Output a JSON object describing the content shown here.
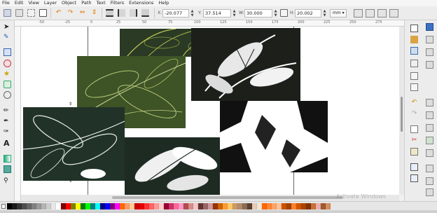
{
  "menu": [
    "File",
    "Edit",
    "View",
    "Layer",
    "Object",
    "Path",
    "Text",
    "Filters",
    "Extensions",
    "Help"
  ],
  "toolbar": {
    "x_label": "X:",
    "x_value": "-20.077",
    "y_label": "Y:",
    "y_value": "37.514",
    "w_label": "W:",
    "w_value": "30.000",
    "h_label": "H:",
    "h_value": "20.002",
    "unit": "mm"
  },
  "ruler": {
    "ticks": [
      "-50",
      "-25",
      "0",
      "25",
      "50",
      "75",
      "100",
      "125",
      "150",
      "175",
      "200",
      "225",
      "250",
      "275"
    ]
  },
  "palette": {
    "colors": [
      "#000000",
      "#1a1a1a",
      "#333333",
      "#4d4d4d",
      "#666666",
      "#808080",
      "#999999",
      "#b3b3b3",
      "#cccccc",
      "#e6e6e6",
      "#ffffff",
      "#800000",
      "#ff0000",
      "#808000",
      "#ffff00",
      "#008000",
      "#00ff00",
      "#008080",
      "#00ffff",
      "#000080",
      "#0000ff",
      "#800080",
      "#ff00ff",
      "#ff6600",
      "#ff9966",
      "#ffcc99",
      "#cc0000",
      "#e60000",
      "#ff3333",
      "#ff6666",
      "#ff9999",
      "#ffcccc",
      "#990033",
      "#cc3366",
      "#ff6699",
      "#ff99cc",
      "#b34d4d",
      "#d98c8c",
      "#f2c6c6",
      "#663333",
      "#996666",
      "#cc9999",
      "#993300",
      "#cc6600",
      "#ff9933",
      "#ffcc66",
      "#cc9966",
      "#b38b6d",
      "#8c6d4f",
      "#5c4033",
      "#e6ccb3",
      "#f2e6d9",
      "#ff6600",
      "#ff8533",
      "#ffa366",
      "#ffc299",
      "#cc5200",
      "#a34100",
      "#ff7f2a",
      "#d45500",
      "#aa4400",
      "#803300",
      "#c87137",
      "#e9afaf",
      "#a05a2c",
      "#d38d5f"
    ],
    "watermark": "Activate Windows"
  }
}
